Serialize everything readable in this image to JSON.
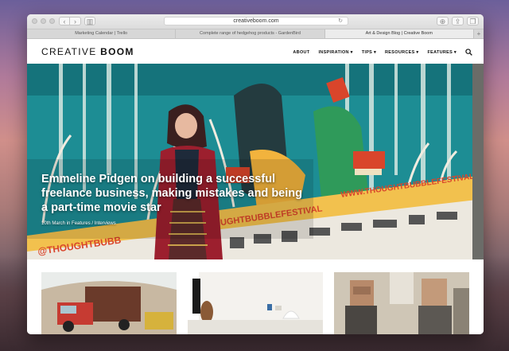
{
  "browser": {
    "url": "creativeboom.com",
    "tabs": [
      {
        "label": "Marketing Calendar | Trello",
        "active": false
      },
      {
        "label": "Complete range of hedgehog products - GardenBird",
        "active": false
      },
      {
        "label": "Art & Design Blog | Creative Boom",
        "active": true
      }
    ],
    "new_tab_label": "+"
  },
  "site": {
    "logo_light": "CREATIVE ",
    "logo_bold": "BOOM",
    "nav": [
      {
        "label": "ABOUT"
      },
      {
        "label": "INSPIRATION ▾"
      },
      {
        "label": "TIPS ▾"
      },
      {
        "label": "RESOURCES ▾"
      },
      {
        "label": "FEATURES ▾"
      }
    ],
    "search_icon": "search-icon"
  },
  "hero": {
    "title": "Emmeline Pidgen on building a successful freelance business, making mistakes and being a part-time movie star",
    "date": "10th March",
    "meta_in": " in ",
    "category_1": "Features",
    "meta_sep": " / ",
    "category_2": "Interviews",
    "banner_text_1": "WWW.THOUGHTBUBBLEFESTIVAL.COM",
    "banner_text_2": "@THOUGHTBUBBLEFESTIVAL",
    "banner_text_3": "@THOUGHTBUBB"
  },
  "colors": {
    "accent": "#1f8a91",
    "banner_yellow": "#f2c14e",
    "banner_text": "#d9452b"
  }
}
